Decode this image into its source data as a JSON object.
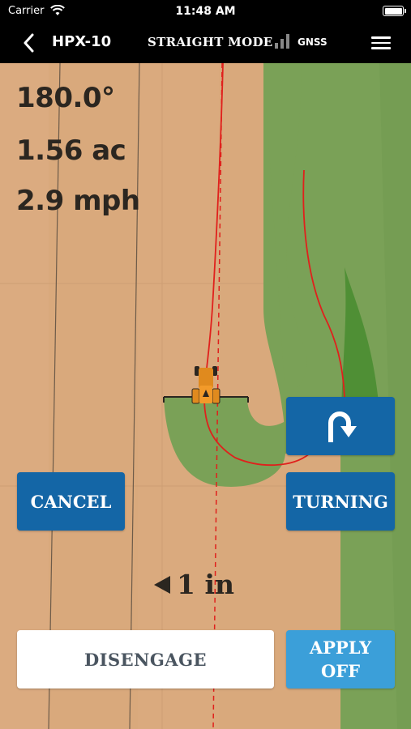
{
  "status_bar": {
    "carrier": "Carrier",
    "time": "11:48 AM",
    "icons": [
      "wifi-icon",
      "battery-icon"
    ]
  },
  "nav": {
    "back_icon": "chevron-left-icon",
    "device": "HPX-10",
    "mode": "STRAIGHT MODE",
    "signal_icon": "signal-bars-icon",
    "gnss": "GNSS",
    "menu_icon": "hamburger-menu-icon"
  },
  "readouts": {
    "heading": "180.0°",
    "area": "1.56 ac",
    "speed": "2.9 mph"
  },
  "controls": {
    "uturn_icon": "u-turn-arrow-icon",
    "cancel": "CANCEL",
    "turning": "TURNING",
    "disengage": "DISENGAGE",
    "apply_line1": "APPLY",
    "apply_line2": "OFF"
  },
  "guidance": {
    "offset_direction_icon": "left-arrow-icon",
    "offset": "1 in"
  },
  "colors": {
    "soil": "#d9a97c",
    "coverage": "#7aa157",
    "coverage_dark": "#4f8f35",
    "guidance_line": "#e0201c",
    "primary_button": "#1466a6",
    "apply_button": "#3b9fd9",
    "bar": "#000000"
  }
}
